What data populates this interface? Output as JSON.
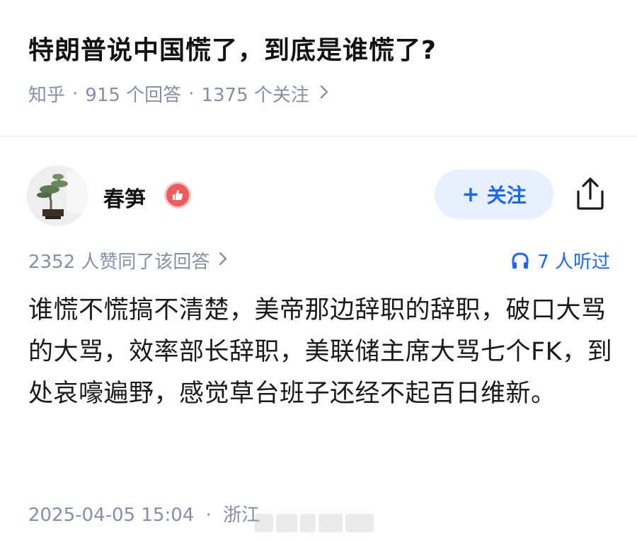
{
  "question": {
    "title": "特朗普说中国慌了，到底是谁慌了?",
    "source": "知乎",
    "answer_count": "915 个回答",
    "follow_count": "1375 个关注"
  },
  "author": {
    "name": "春笋",
    "follow_label": "关注"
  },
  "answer": {
    "votes": "2352 人赞同了该回答",
    "listens": "7 人听过",
    "text": "谁慌不慌搞不清楚，美帝那边辞职的辞职，破口大骂的大骂，效率部长辞职，美联储主席大骂七个FK，到处哀嚎遍野，感觉草台班子还经不起百日维新。",
    "date": "2025-04-05 15:04",
    "location": "浙江"
  },
  "colors": {
    "accent": "#1a66ff",
    "meta": "#8590a6",
    "follow_bg": "#e8f0fe",
    "badge": "#f05a5a"
  },
  "icons": [
    "chevron-right-icon",
    "plus-icon",
    "share-icon",
    "headphones-icon",
    "thumbs-up-badge-icon"
  ]
}
